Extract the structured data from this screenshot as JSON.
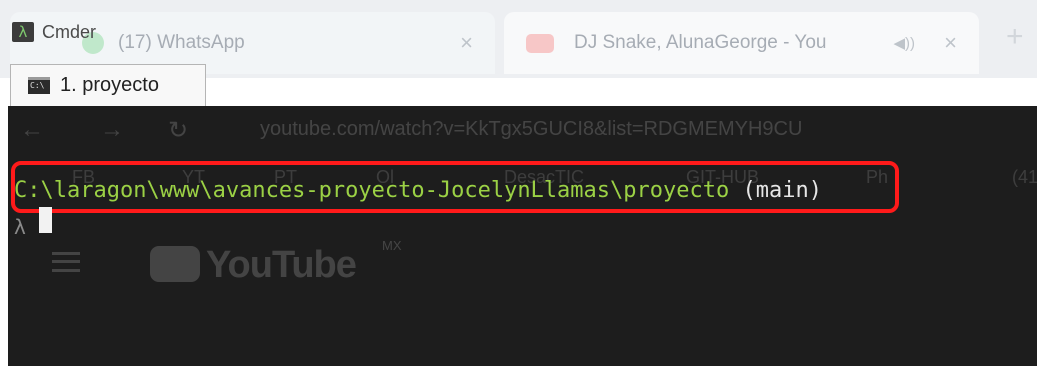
{
  "window": {
    "app_title": "Cmder",
    "app_icon_glyph": "λ",
    "accent_color": "#9bd145"
  },
  "tabs": [
    {
      "label": "1. proyecto",
      "icon": "console-icon",
      "active": true
    }
  ],
  "terminal": {
    "cwd": "C:\\laragon\\www\\avances-proyecto-JocelynLlamas\\proyecto",
    "branch": "(main)",
    "prompt_symbol": "λ",
    "highlight_color": "#ff1a1a"
  },
  "background_browser": {
    "tab_1": "(17) WhatsApp",
    "tab_2": "DJ Snake, AlunaGeorge - You",
    "url": "youtube.com/watch?v=KkTgx5GUCI8&list=RDGMEMYH9CU",
    "bookmarks": [
      "FB",
      "YT",
      "PT",
      "Ol",
      "DesacTIC",
      "GIT-HUB",
      "Ph",
      "(41"
    ],
    "logo_text": "YouTube",
    "region": "MX"
  }
}
